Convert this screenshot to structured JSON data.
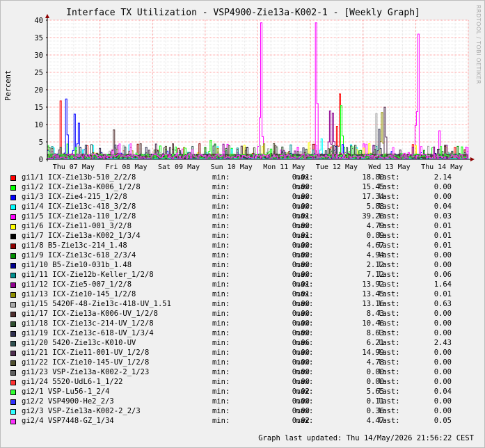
{
  "title": "Interface TX Utilization - VSP4900-Zie13a-K002-1 - [Weekly Graph]",
  "watermark": "RRDTOOL / TOBI OETIKER",
  "updated_label": "Graph last updated: Thu 14/May/2026 21:56:22 CEST",
  "labels": {
    "min": "min:",
    "max": "max:",
    "last": "last:"
  },
  "colors": {
    "grid": "#ff9b9b",
    "axis": "#000000",
    "canvas": "#ffffff",
    "background": "#f0f0f0"
  },
  "chart_data": {
    "type": "line",
    "ylabel": "Percent",
    "ylim": [
      0,
      40
    ],
    "yticks": [
      0,
      5,
      10,
      15,
      20,
      25,
      30,
      35,
      40
    ],
    "grid": true,
    "legend_position": "bottom",
    "x_days": [
      "Thu 07 May",
      "Fri 08 May",
      "Sat 09 May",
      "Sun 10 May",
      "Mon 11 May",
      "Tue 12 May",
      "Wed 13 May",
      "Thu 14 May"
    ],
    "series": [
      {
        "name": "gi1/1 ICX-Zie13b-510_2/2/8",
        "color": "#ff0000",
        "min": "0.01",
        "max": "18.80",
        "last": "2.14",
        "peaks": [
          {
            "day": 0.25,
            "value": 16.8
          },
          {
            "day": 5.5,
            "value": 9.5
          },
          {
            "day": 5.55,
            "value": 18.8
          }
        ]
      },
      {
        "name": "gi1/2 ICX-Zie13a-K006_1/2/8",
        "color": "#00ff00",
        "min": "0.00",
        "max": "15.45",
        "last": "0.00",
        "peaks": [
          {
            "day": 3.1,
            "value": 5.5
          },
          {
            "day": 5.58,
            "value": 15.45
          }
        ]
      },
      {
        "name": "gi1/3 ICX-Zie4-215_1/2/8",
        "color": "#0000ff",
        "min": "0.00",
        "max": "17.34",
        "last": "0.00",
        "peaks": [
          {
            "day": 0.35,
            "value": 17.34
          },
          {
            "day": 0.5,
            "value": 13.0
          },
          {
            "day": 0.58,
            "value": 10.4
          }
        ]
      },
      {
        "name": "gi1/4 ICX-Zie13c-418_3/2/8",
        "color": "#00ffff",
        "min": "0.00",
        "max": "5.88",
        "last": "0.04",
        "peaks": [
          {
            "day": 5.2,
            "value": 5.88
          }
        ]
      },
      {
        "name": "gi1/5 ICX-Zie12a-110_1/2/8",
        "color": "#ff00ff",
        "min": "0.01",
        "max": "39.26",
        "last": "0.03",
        "peaks": [
          {
            "day": 4.05,
            "value": 39.26
          },
          {
            "day": 5.1,
            "value": 39.26
          },
          {
            "day": 7.0,
            "value": 38.0
          },
          {
            "day": 7.05,
            "value": 36.0
          },
          {
            "day": 7.45,
            "value": 8.2
          }
        ]
      },
      {
        "name": "gi1/6 ICX-Zie11-001_3/2/8",
        "color": "#ffff00",
        "min": "0.00",
        "max": "4.79",
        "last": "0.01",
        "peaks": [
          {
            "day": 4.95,
            "value": 4.79
          },
          {
            "day": 6.1,
            "value": 4.5
          }
        ]
      },
      {
        "name": "gi1/7 ICX-Zie13a-K002_1/3/4",
        "color": "#000000",
        "min": "0.01",
        "max": "0.89",
        "last": "0.01",
        "peaks": []
      },
      {
        "name": "gi1/8 B5-Zie13c-214_1.48",
        "color": "#8f0000",
        "min": "0.00",
        "max": "4.67",
        "last": "0.01",
        "peaks": []
      },
      {
        "name": "gi1/9 ICX-Zie13c-618_2/3/4",
        "color": "#008f00",
        "min": "0.00",
        "max": "4.94",
        "last": "0.00",
        "peaks": []
      },
      {
        "name": "gi1/10 B5-Zie10-031b_1.48",
        "color": "#00008f",
        "min": "0.00",
        "max": "2.12",
        "last": "0.00",
        "peaks": []
      },
      {
        "name": "gi1/11 ICX-Zie12b-Keller_1/2/8",
        "color": "#008f8f",
        "min": "0.00",
        "max": "7.12",
        "last": "0.06",
        "peaks": []
      },
      {
        "name": "gi1/12 ICX-Zie5-007_1/2/8",
        "color": "#8f008f",
        "min": "0.01",
        "max": "13.92",
        "last": "1.64",
        "peaks": [
          {
            "day": 5.35,
            "value": 13.92
          },
          {
            "day": 5.42,
            "value": 13.3
          }
        ]
      },
      {
        "name": "gi1/13 ICX-Zie10-145_1/2/8",
        "color": "#8f8f00",
        "min": "0.01",
        "max": "13.45",
        "last": "0.01",
        "peaks": [
          {
            "day": 6.35,
            "value": 13.45
          }
        ]
      },
      {
        "name": "gi1/15 5420F-48-Zie13c-418-UV_1.51",
        "color": "#a8a8a8",
        "min": "0.00",
        "max": "13.16",
        "last": "0.63",
        "peaks": [
          {
            "day": 6.25,
            "value": 13.16
          },
          {
            "day": 4.2,
            "value": 9.0
          }
        ]
      },
      {
        "name": "gi1/17 ICX-Zie13a-K006-UV_1/2/8",
        "color": "#4f2f2f",
        "min": "0.00",
        "max": "8.43",
        "last": "0.00",
        "peaks": [
          {
            "day": 1.25,
            "value": 8.43
          }
        ]
      },
      {
        "name": "gi1/18 ICX-Zie13c-214-UV_1/2/8",
        "color": "#2f4f2f",
        "min": "0.00",
        "max": "10.46",
        "last": "0.00",
        "peaks": [
          {
            "day": 6.2,
            "value": 10.46
          }
        ]
      },
      {
        "name": "gi1/19 ICX-Zie13c-618-UV_1/3/4",
        "color": "#2f2f4f",
        "min": "0.00",
        "max": "8.63",
        "last": "0.00",
        "peaks": [
          {
            "day": 6.3,
            "value": 8.63
          }
        ]
      },
      {
        "name": "gi1/20 5420-Zie13c-K010-UV",
        "color": "#2f4f4f",
        "min": "0.06",
        "max": "6.21",
        "last": "2.43",
        "peaks": []
      },
      {
        "name": "gi1/21 ICX-Zie11-001-UV_1/2/8",
        "color": "#4f2f4f",
        "min": "0.00",
        "max": "14.99",
        "last": "0.00",
        "peaks": [
          {
            "day": 6.4,
            "value": 14.99
          }
        ]
      },
      {
        "name": "gi1/22 ICX-Zie10-145-UV_1/2/8",
        "color": "#4f4f2f",
        "min": "0.00",
        "max": "4.78",
        "last": "0.00",
        "peaks": []
      },
      {
        "name": "gi1/23 VSP-Zie13a-K002-2_1/23",
        "color": "#5f5f5f",
        "min": "0.00",
        "max": "0.00",
        "last": "0.00",
        "peaks": []
      },
      {
        "name": "gi1/24 5520-UdL6-1_1/22",
        "color": "#ff3030",
        "min": "0.00",
        "max": "0.00",
        "last": "0.00",
        "peaks": []
      },
      {
        "name": "gi2/1 VSP-Lu56-1_2/4",
        "color": "#30ff30",
        "min": "0.02",
        "max": "5.65",
        "last": "0.04",
        "peaks": []
      },
      {
        "name": "gi2/2 VSP4900-He2_2/3",
        "color": "#3030ff",
        "min": "0.00",
        "max": "0.11",
        "last": "0.00",
        "peaks": []
      },
      {
        "name": "gi2/3 VSP-Zie13a-K002-2_2/3",
        "color": "#30ffff",
        "min": "0.00",
        "max": "0.36",
        "last": "0.00",
        "peaks": []
      },
      {
        "name": "gi2/4 VSP7448-GZ_1/34",
        "color": "#ff30ff",
        "min": "0.02",
        "max": "4.47",
        "last": "0.05",
        "peaks": []
      }
    ]
  }
}
